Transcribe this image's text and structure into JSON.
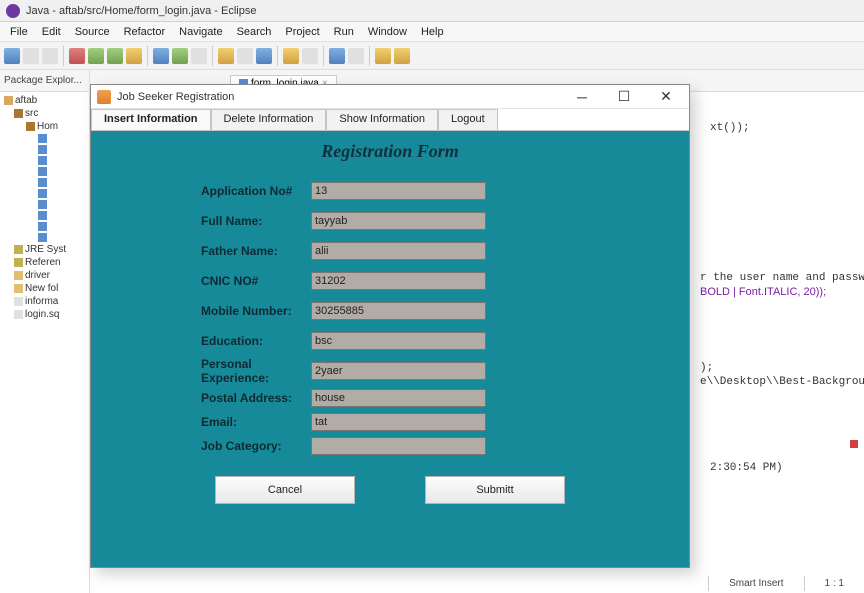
{
  "eclipse": {
    "title": "Java - aftab/src/Home/form_login.java - Eclipse",
    "menus": [
      "File",
      "Edit",
      "Source",
      "Refactor",
      "Navigate",
      "Search",
      "Project",
      "Run",
      "Window",
      "Help"
    ]
  },
  "explorer": {
    "tab": "Package Explor...",
    "items": [
      {
        "cls": "",
        "icon": "i-proj",
        "label": "aftab"
      },
      {
        "cls": "indent1",
        "icon": "i-pkg",
        "label": "src"
      },
      {
        "cls": "indent2",
        "icon": "i-pkg",
        "label": "Hom"
      },
      {
        "cls": "indent3",
        "icon": "i-java",
        "label": ""
      },
      {
        "cls": "indent3",
        "icon": "i-java",
        "label": ""
      },
      {
        "cls": "indent3",
        "icon": "i-java",
        "label": ""
      },
      {
        "cls": "indent3",
        "icon": "i-java",
        "label": ""
      },
      {
        "cls": "indent3",
        "icon": "i-java",
        "label": ""
      },
      {
        "cls": "indent3",
        "icon": "i-java",
        "label": ""
      },
      {
        "cls": "indent3",
        "icon": "i-java",
        "label": ""
      },
      {
        "cls": "indent3",
        "icon": "i-java",
        "label": ""
      },
      {
        "cls": "indent3",
        "icon": "i-java",
        "label": ""
      },
      {
        "cls": "indent3",
        "icon": "i-java",
        "label": ""
      },
      {
        "cls": "indent1",
        "icon": "i-jar",
        "label": "JRE Syst"
      },
      {
        "cls": "indent1",
        "icon": "i-jar",
        "label": "Referen"
      },
      {
        "cls": "indent1",
        "icon": "i-fold",
        "label": "driver"
      },
      {
        "cls": "indent1",
        "icon": "i-fold",
        "label": "New fol"
      },
      {
        "cls": "indent1",
        "icon": "i-file",
        "label": "informa"
      },
      {
        "cls": "indent1",
        "icon": "i-file",
        "label": "login.sq"
      }
    ]
  },
  "editor": {
    "tab": "form_login.java",
    "line1": "xt());",
    "line2a": "r the user name and passwo",
    "line2b": "BOLD | Font.ITALIC, 20));",
    "line3": ");",
    "line4": "e\\\\Desktop\\\\Best-Backgroun",
    "line5": "2:30:54 PM)"
  },
  "dialog": {
    "title": "Job Seeker  Registration",
    "tabs": [
      "Insert Information",
      "Delete Information",
      "Show Information",
      "Logout"
    ],
    "heading": "Registration Form",
    "labels": {
      "app_no": "Application No#",
      "name": "Full Name:",
      "father": "Father Name:",
      "cnic": "CNIC NO#",
      "mobile": "Mobile Number:",
      "edu": "Education:",
      "exp": "Personal Experience:",
      "addr": "Postal Address:",
      "email": "Email:",
      "cat": "Job Category:"
    },
    "values": {
      "app_no": "13",
      "name": "tayyab",
      "father": "alii",
      "cnic": "31202",
      "mobile": "30255885",
      "edu": "bsc",
      "exp": "2yaer",
      "addr": "house",
      "email": "tat",
      "cat": ""
    },
    "buttons": {
      "cancel": "Cancel",
      "submit": "Submitt"
    }
  },
  "status": {
    "mode": "Smart Insert",
    "pos": "1 : 1"
  }
}
